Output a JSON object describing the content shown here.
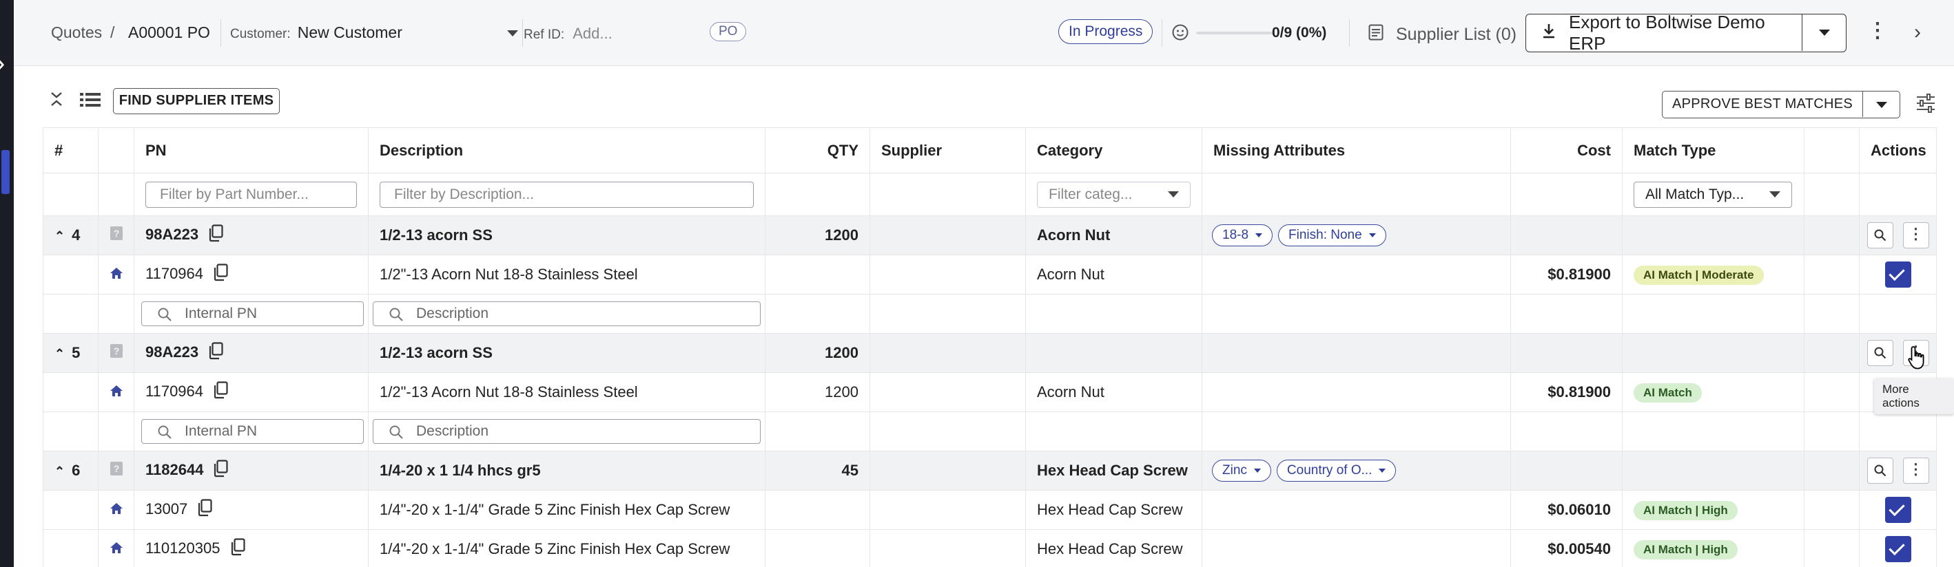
{
  "header": {
    "breadcrumb_root": "Quotes",
    "breadcrumb_sep": "/",
    "breadcrumb_current": "A00001 PO",
    "customer_label": "Customer:",
    "customer_value": "New Customer",
    "ref_label": "Ref ID:",
    "ref_placeholder": "Add...",
    "type_tag": "PO",
    "status": "In Progress",
    "progress_text": "0/9 (0%)",
    "progress_fraction": 0,
    "supplier_list": "Supplier List (0)",
    "export_label": "Export to Boltwise Demo ERP"
  },
  "toolbar": {
    "find_supplier_items": "FIND SUPPLIER ITEMS",
    "approve_best_matches": "APPROVE BEST MATCHES"
  },
  "table": {
    "columns": [
      "#",
      "PN",
      "Description",
      "QTY",
      "Supplier",
      "Category",
      "Missing Attributes",
      "Cost",
      "Match Type",
      "Actions"
    ],
    "filters": {
      "pn": "Filter by Part Number...",
      "description": "Filter by Description...",
      "category": "Filter categ...",
      "match_type": "All Match Typ..."
    },
    "subrow_inputs": {
      "internal_pn": "Internal PN",
      "description": "Description"
    },
    "groups": [
      {
        "num": "4",
        "pn": "98A223",
        "description": "1/2-13 acorn SS",
        "qty": "1200",
        "category": "Acorn Nut",
        "chips": [
          "18-8",
          "Finish: None"
        ],
        "matches": [
          {
            "pn": "1170964",
            "description": "1/2\"-13 Acorn Nut 18-8 Stainless Steel",
            "qty": "",
            "category": "Acorn Nut",
            "cost": "$0.81900",
            "match": "AI Match | Moderate",
            "match_style": "mod"
          }
        ]
      },
      {
        "num": "5",
        "pn": "98A223",
        "description": "1/2-13 acorn SS",
        "qty": "1200",
        "category": "",
        "chips": [],
        "matches": [
          {
            "pn": "1170964",
            "description": "1/2\"-13 Acorn Nut 18-8 Stainless Steel",
            "qty": "1200",
            "category": "Acorn Nut",
            "cost": "$0.81900",
            "match": "AI Match",
            "match_style": "ok"
          }
        ]
      },
      {
        "num": "6",
        "pn": "1182644",
        "description": "1/4-20 x 1 1/4 hhcs gr5",
        "qty": "45",
        "category": "Hex Head Cap Screw",
        "chips": [
          "Zinc",
          "Country of O..."
        ],
        "matches": [
          {
            "pn": "13007",
            "description": "1/4\"-20 x 1-1/4\" Grade 5 Zinc Finish Hex Cap Screw",
            "qty": "",
            "category": "Hex Head Cap Screw",
            "cost": "$0.06010",
            "match": "AI Match | High",
            "match_style": "ok"
          },
          {
            "pn": "110120305",
            "description": "1/4\"-20 x 1-1/4\" Grade 5 Zinc Finish Hex Cap Screw",
            "qty": "",
            "category": "Hex Head Cap Screw",
            "cost": "$0.00540",
            "match": "AI Match | High",
            "match_style": "ok"
          }
        ]
      }
    ]
  },
  "tooltip": "More actions",
  "colors": {
    "accent": "#2f3fa6",
    "badge_moderate": "#eaf0b6",
    "badge_high": "#d6efcf"
  },
  "icons": [
    "chevron-right-icon",
    "smiley-icon",
    "list-icon",
    "download-icon",
    "kebab-icon",
    "collapse-icon",
    "settings-sliders-icon",
    "copy-icon",
    "house-icon",
    "question-icon",
    "search-icon",
    "check-icon",
    "cursor-hand-icon"
  ]
}
